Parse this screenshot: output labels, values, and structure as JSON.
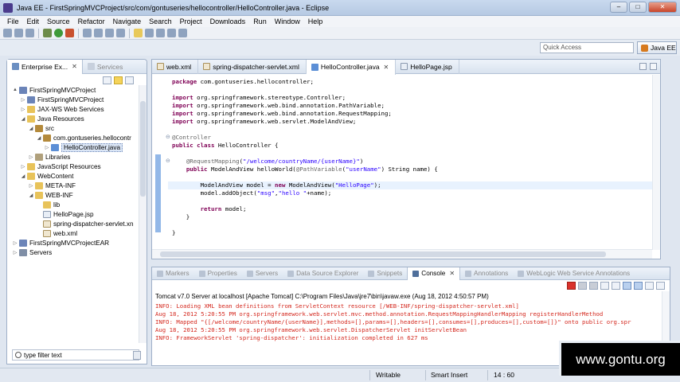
{
  "window": {
    "title": "Java EE - FirstSpringMVCProject/src/com/gontuseries/hellocontroller/HelloController.java - Eclipse",
    "controls": {
      "minimize": "–",
      "maximize": "□",
      "close": "✕"
    }
  },
  "menu": [
    "File",
    "Edit",
    "Source",
    "Refactor",
    "Navigate",
    "Search",
    "Project",
    "Downloads",
    "Run",
    "Window",
    "Help"
  ],
  "quick_access": {
    "placeholder": "Quick Access"
  },
  "perspective": {
    "label": "Java EE"
  },
  "left_panel": {
    "tabs": [
      {
        "label": "Enterprise Ex...",
        "active": true
      },
      {
        "label": "Services",
        "active": false
      }
    ],
    "tree": [
      {
        "label": "FirstSpringMVCProject",
        "depth": 0,
        "twisty": "▲",
        "icon": "project"
      },
      {
        "label": "FirstSpringMVCProject",
        "depth": 1,
        "twisty": "▷",
        "icon": "project"
      },
      {
        "label": "JAX-WS Web Services",
        "depth": 1,
        "twisty": "▷",
        "icon": "folder"
      },
      {
        "label": "Java Resources",
        "depth": 1,
        "twisty": "◢",
        "icon": "folder"
      },
      {
        "label": "src",
        "depth": 2,
        "twisty": "◢",
        "icon": "pkg"
      },
      {
        "label": "com.gontuseries.hellocontr",
        "depth": 3,
        "twisty": "◢",
        "icon": "pkg"
      },
      {
        "label": "HelloController.java",
        "depth": 4,
        "twisty": "▷",
        "icon": "java",
        "selected": true
      },
      {
        "label": "Libraries",
        "depth": 2,
        "twisty": "▷",
        "icon": "lib"
      },
      {
        "label": "JavaScript Resources",
        "depth": 1,
        "twisty": "▷",
        "icon": "folder"
      },
      {
        "label": "WebContent",
        "depth": 1,
        "twisty": "◢",
        "icon": "folder"
      },
      {
        "label": "META-INF",
        "depth": 2,
        "twisty": "▷",
        "icon": "folder"
      },
      {
        "label": "WEB-INF",
        "depth": 2,
        "twisty": "◢",
        "icon": "folder"
      },
      {
        "label": "lib",
        "depth": 3,
        "twisty": "",
        "icon": "folder"
      },
      {
        "label": "HelloPage.jsp",
        "depth": 3,
        "twisty": "",
        "icon": "file"
      },
      {
        "label": "spring-dispatcher-servlet.xn",
        "depth": 3,
        "twisty": "",
        "icon": "xml"
      },
      {
        "label": "web.xml",
        "depth": 3,
        "twisty": "",
        "icon": "xml"
      },
      {
        "label": "FirstSpringMVCProjectEAR",
        "depth": 0,
        "twisty": "▷",
        "icon": "project"
      },
      {
        "label": "Servers",
        "depth": 0,
        "twisty": "▷",
        "icon": "server"
      }
    ],
    "filter_placeholder": "type filter text"
  },
  "editor": {
    "tabs": [
      {
        "label": "web.xml",
        "active": false
      },
      {
        "label": "spring-dispatcher-servlet.xml",
        "active": false
      },
      {
        "label": "HelloController.java",
        "active": true
      },
      {
        "label": "HelloPage.jsp",
        "active": false
      }
    ],
    "code": [
      "package com.gontuseries.hellocontroller;",
      "",
      "import org.springframework.stereotype.Controller;",
      "import org.springframework.web.bind.annotation.PathVariable;",
      "import org.springframework.web.bind.annotation.RequestMapping;",
      "import org.springframework.web.servlet.ModelAndView;",
      "",
      "@Controller",
      "public class HelloController {",
      "",
      "    @RequestMapping(\"/welcome/countryName/{userName}\")",
      "    public ModelAndView helloWorld(@PathVariable(\"userName\") String name) {",
      "",
      "        ModelAndView model = new ModelAndView(\"HelloPage\");",
      "        model.addObject(\"msg\",\"hello \"+name);",
      "",
      "        return model;",
      "    }",
      "",
      "}"
    ]
  },
  "console": {
    "tabs": [
      {
        "label": "Markers",
        "active": false
      },
      {
        "label": "Properties",
        "active": false
      },
      {
        "label": "Servers",
        "active": false
      },
      {
        "label": "Data Source Explorer",
        "active": false
      },
      {
        "label": "Snippets",
        "active": false
      },
      {
        "label": "Console",
        "active": true
      },
      {
        "label": "Annotations",
        "active": false
      },
      {
        "label": "WebLogic Web Service Annotations",
        "active": false
      }
    ],
    "server_line": "Tomcat v7.0 Server at localhost [Apache Tomcat] C:\\Program Files\\Java\\jre7\\bin\\javaw.exe (Aug 18, 2012 4:50:57 PM)",
    "lines": [
      "INFO: Loading XML bean definitions from ServletContext resource [/WEB-INF/spring-dispatcher-servlet.xml]",
      "Aug 18, 2012 5:20:55 PM org.springframework.web.servlet.mvc.method.annotation.RequestMappingHandlerMapping registerHandlerMethod",
      "INFO: Mapped \"{[/welcome/countryName/{userName}],methods=[],params=[],headers=[],consumes=[],produces=[],custom=[]}\" onto public org.spr",
      "Aug 18, 2012 5:20:55 PM org.springframework.web.servlet.DispatcherServlet initServletBean",
      "INFO: FrameworkServlet 'spring-dispatcher': initialization completed in 627 ms"
    ]
  },
  "status": {
    "writable": "Writable",
    "insert_mode": "Smart Insert",
    "position": "14 : 60"
  },
  "watermark": "www.gontu.org",
  "colors": {
    "keyword": "#7f0055",
    "string": "#2a00ff",
    "annotation": "#646464",
    "console_error": "#d4281e"
  }
}
